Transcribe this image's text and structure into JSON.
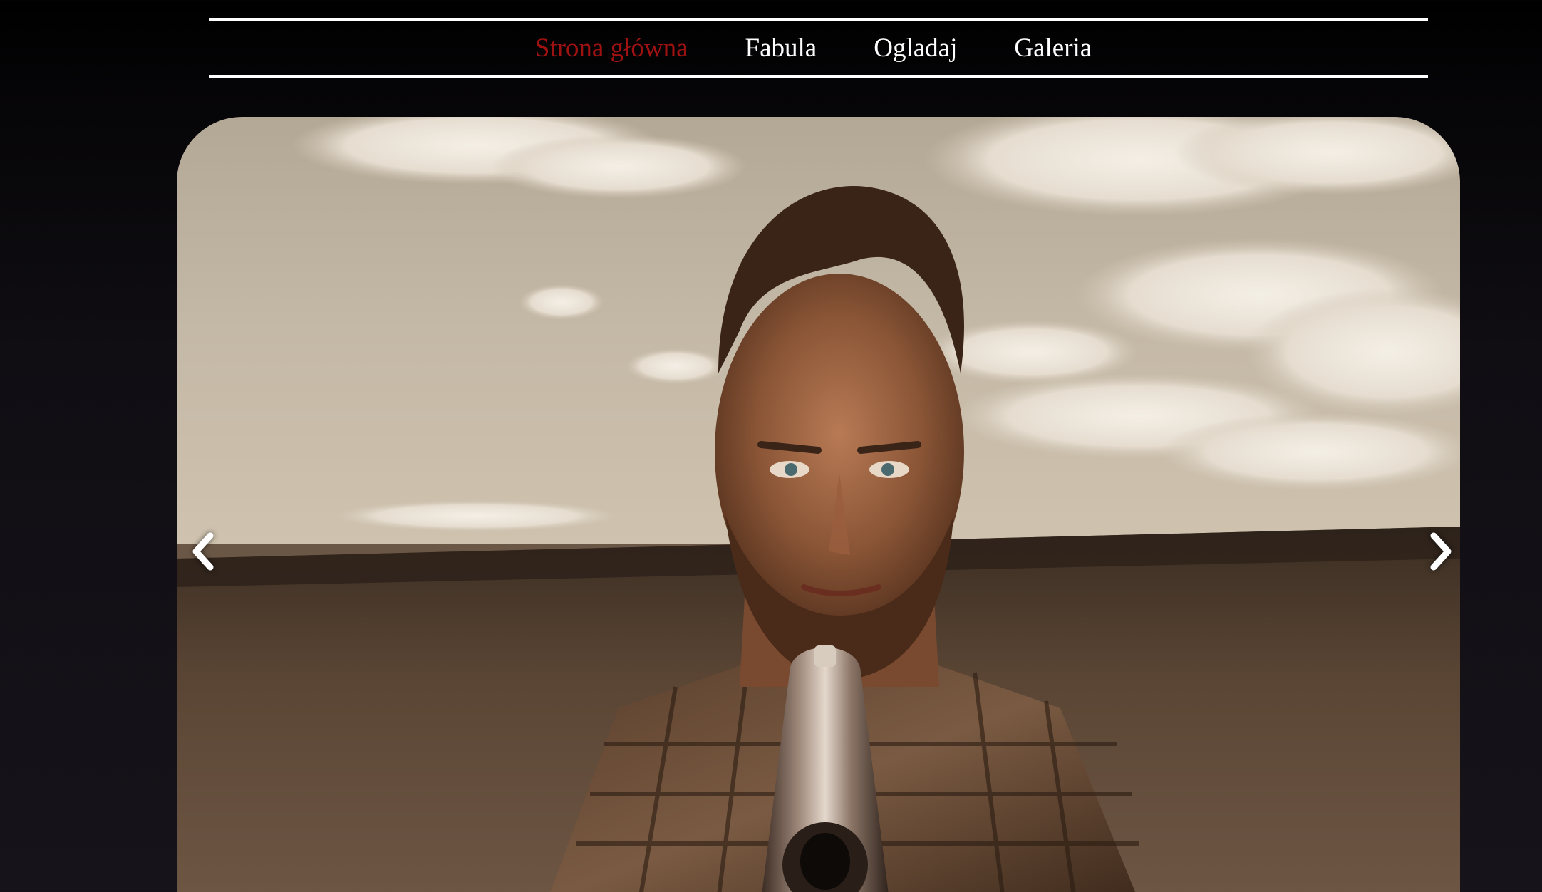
{
  "nav": {
    "items": [
      {
        "label": "Strona główna",
        "active": true
      },
      {
        "label": "Fabula",
        "active": false
      },
      {
        "label": "Ogladaj",
        "active": false
      },
      {
        "label": "Galeria",
        "active": false
      }
    ],
    "active_color": "#a01212",
    "text_color": "#ffffff"
  },
  "carousel": {
    "prev_icon": "chevron-left-icon",
    "next_icon": "chevron-right-icon",
    "slide_image": "man-aiming-pistol-desert-photo"
  }
}
